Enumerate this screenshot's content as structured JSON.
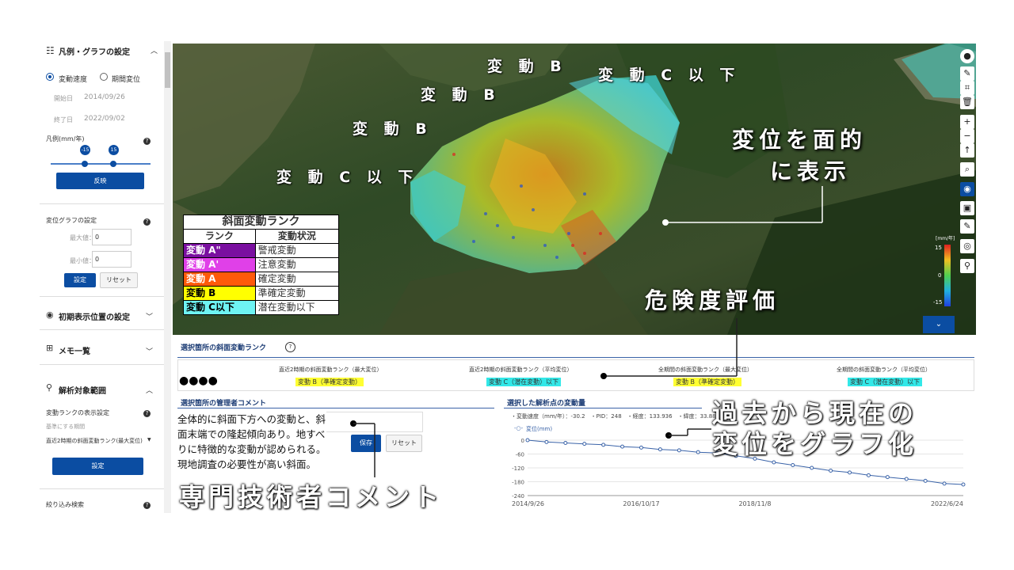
{
  "sidebar": {
    "legend_header": "凡例・グラフの設定",
    "radio_velocity": "変動速度",
    "radio_period": "期間変位",
    "start_label": "開始日",
    "start_value": "2014/09/26",
    "end_label": "終了日",
    "end_value": "2022/09/02",
    "legend_unit": "凡例(mm/年)",
    "slider_min": "-15",
    "slider_max": "15",
    "apply_button": "反映",
    "graph_settings": "変位グラフの設定",
    "max_label": "最大値：",
    "max_value": "0",
    "min_label": "最小値：",
    "min_value": "0",
    "set_button": "設定",
    "reset_button": "リセット",
    "initial_position": "初期表示位置の設定",
    "memo_list": "メモ一覧",
    "analysis_range": "解析対象範囲",
    "rank_display": "変動ランクの表示設定",
    "base_period_label": "基準にする期間",
    "base_period_value": "直近2時期の斜面変動ランク(最大変位)",
    "set_button2": "設定",
    "filter_search": "絞り込み検索"
  },
  "map": {
    "labels": [
      "変 動 B",
      "変 動 B",
      "変 動 B",
      "変 動 C 以 下",
      "変 動 C 以 下"
    ],
    "callout_surface_1": "変位を面的",
    "callout_surface_2": "に表示",
    "callout_risk": "危険度評価",
    "scale_unit": "[mm/年]",
    "scale_max": "15",
    "scale_zero": "0",
    "scale_min": "-15",
    "expand_icon": "chevron-down-icon"
  },
  "rank_table": {
    "title": "斜面変動ランク",
    "col_rank": "ランク",
    "col_status": "変動状況",
    "rows": [
      {
        "rank": "変動 A\"",
        "status": "警戒変動",
        "color": "#7a0fa0"
      },
      {
        "rank": "変動 A'",
        "status": "注意変動",
        "color": "#e040e8"
      },
      {
        "rank": "変動 A",
        "status": "確定変動",
        "color": "#ff5a0a"
      },
      {
        "rank": "変動 B",
        "status": "準確定変動",
        "color": "#ffff00"
      },
      {
        "rank": "変動 C以下",
        "status": "潜在変動以下",
        "color": "#6ef3f3"
      }
    ]
  },
  "rank_panel": {
    "title": "選択箇所の斜面変動ランク",
    "dots": "●●●●",
    "columns": [
      {
        "header": "直近2時期の斜面変動ランク（最大変位）",
        "value": "変動 B（準確定変動）",
        "color": "#ffff33"
      },
      {
        "header": "直近2時期の斜面変動ランク（平均変位）",
        "value": "変動 C（潜在変動）以下",
        "color": "#33e8e8"
      },
      {
        "header": "全期間の斜面変動ランク（最大変位）",
        "value": "変動 B（準確定変動）",
        "color": "#ffff33"
      },
      {
        "header": "全期間の斜面変動ランク（平均変位）",
        "value": "変動 C（潜在変動）以下",
        "color": "#33e8e8"
      }
    ]
  },
  "comment_panel": {
    "title": "選択箇所の管理者コメント",
    "text_1": "全体的に斜面下方への変動と、斜",
    "text_2": "面末端での隆起傾向あり。地すべ",
    "text_3": "りに特徴的な変動が認められる。",
    "text_4": "現地調査の必要性が高い斜面。",
    "save_button": "保存",
    "reset_button": "リセット",
    "caption": "専門技術者コメント"
  },
  "graph_panel": {
    "title": "選択した解析点の変動量",
    "info": "・変動速度（mm/年）：-30.2　・PID：248　・経度：133.936　・緯度：33.88",
    "legend": "変位(mm)",
    "caption_1": "過去から現在の",
    "caption_2": "変位をグラフ化",
    "y_ticks": [
      "0",
      "-60",
      "-120",
      "-180",
      "-240"
    ],
    "x_ticks": [
      "2014/9/26",
      "2016/10/17",
      "2018/11/8",
      "2022/6/24"
    ]
  },
  "chart_data": {
    "type": "line",
    "title": "",
    "xlabel": "",
    "ylabel": "変位(mm)",
    "ylim": [
      -240,
      0
    ],
    "x": [
      "2014/9/26",
      "2015/3",
      "2015/9",
      "2016/1",
      "2016/5",
      "2016/10",
      "2017/3",
      "2017/7",
      "2017/11",
      "2018/3",
      "2018/5",
      "2018/8",
      "2018/11",
      "2019/3",
      "2019/7",
      "2019/11",
      "2020/3",
      "2020/7",
      "2020/11",
      "2021/3",
      "2021/7",
      "2021/11",
      "2022/3",
      "2022/6/24"
    ],
    "series": [
      {
        "name": "変位(mm)",
        "values": [
          0,
          -8,
          -12,
          -16,
          -20,
          -28,
          -32,
          -40,
          -44,
          -52,
          -56,
          -68,
          -80,
          -96,
          -108,
          -120,
          -132,
          -140,
          -152,
          -160,
          -168,
          -176,
          -188,
          -192
        ]
      }
    ]
  }
}
